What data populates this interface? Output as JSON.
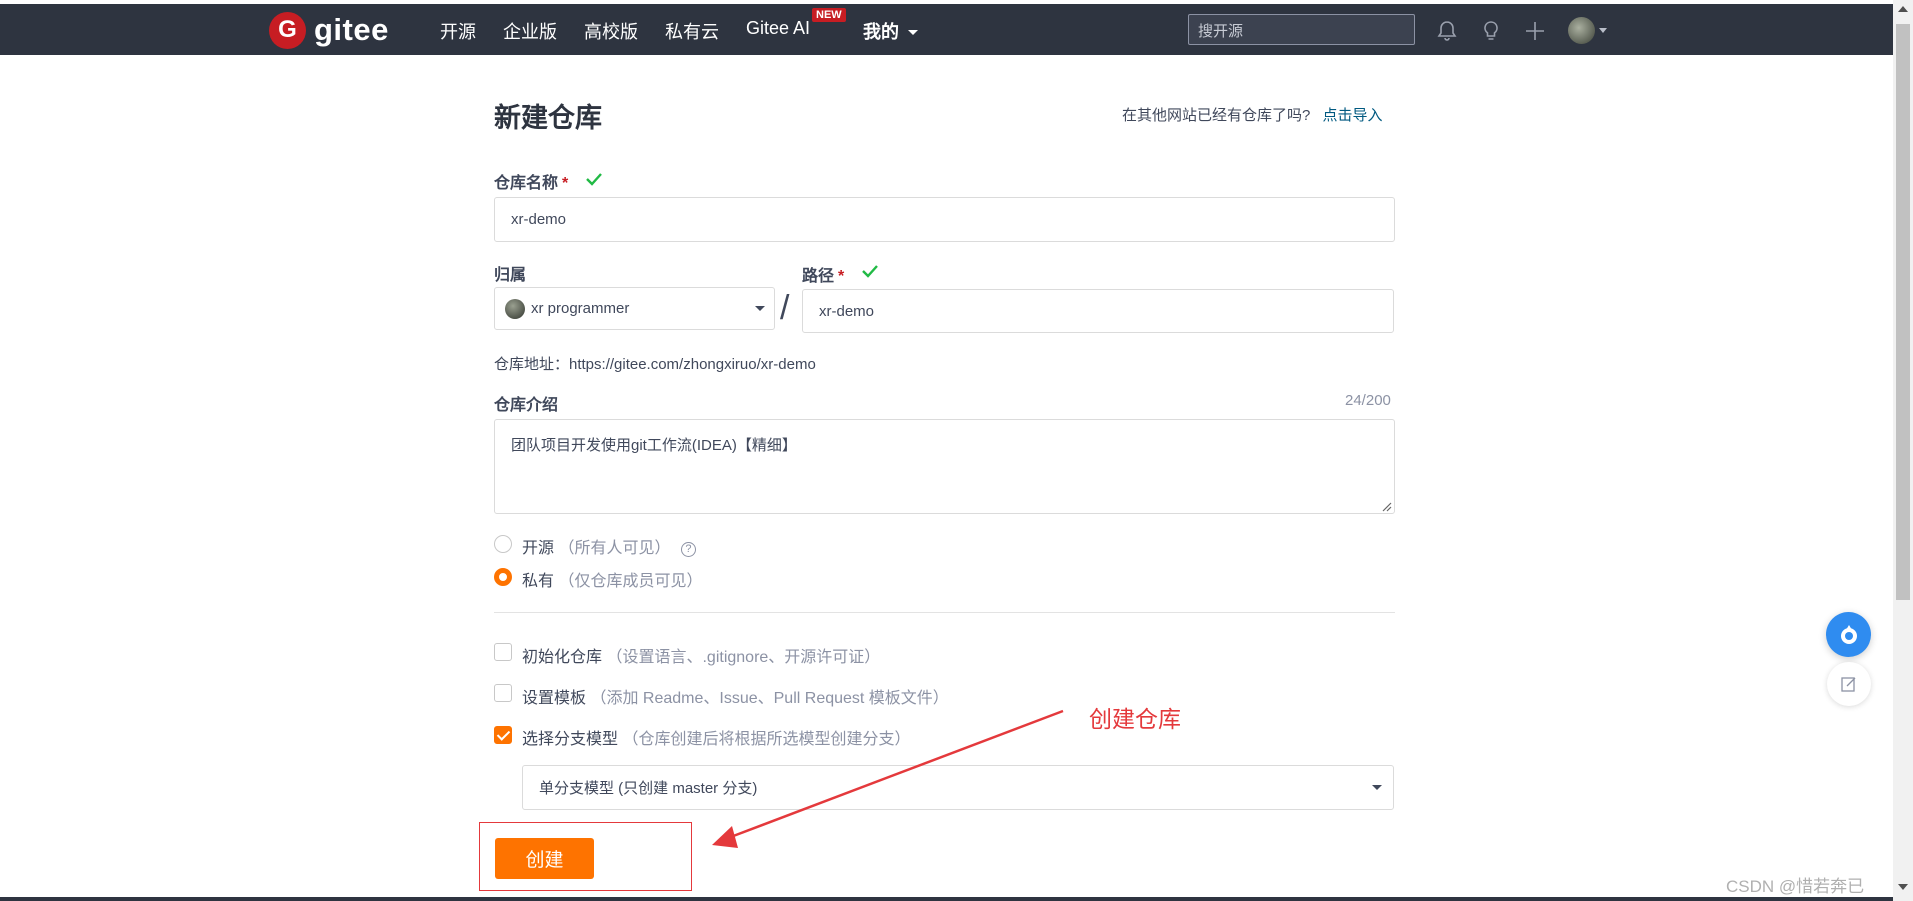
{
  "navbar": {
    "logo_text": "gitee",
    "logo_mark": "G",
    "items": [
      "开源",
      "企业版",
      "高校版",
      "私有云",
      "Gitee AI",
      "我的"
    ],
    "new_badge": "NEW",
    "search_placeholder": "搜开源",
    "icons": [
      "bell-icon",
      "lightbulb-icon",
      "plus-icon",
      "user-avatar"
    ]
  },
  "page": {
    "title": "新建仓库",
    "import_prompt": "在其他网站已经有仓库了吗?",
    "import_link": "点击导入"
  },
  "form": {
    "repo_name_label": "仓库名称",
    "repo_name_value": "xr-demo",
    "owner_label": "归属",
    "owner_value": "xr programmer",
    "path_label": "路径",
    "path_value": "xr-demo",
    "required_mark": "*",
    "separator": "/",
    "repo_url": "仓库地址：https://gitee.com/zhongxiruo/xr-demo",
    "desc_label": "仓库介绍",
    "desc_counter": "24/200",
    "desc_value": "团队项目开发使用git工作流(IDEA)【精细】",
    "visibility": [
      {
        "label": "开源",
        "hint": "（所有人可见）",
        "checked": false
      },
      {
        "label": "私有",
        "hint": "（仅仓库成员可见）",
        "checked": true
      }
    ],
    "options": [
      {
        "label": "初始化仓库",
        "hint": "（设置语言、.gitignore、开源许可证）",
        "checked": false
      },
      {
        "label": "设置模板",
        "hint": "（添加 Readme、Issue、Pull Request 模板文件）",
        "checked": false
      },
      {
        "label": "选择分支模型",
        "hint": "（仓库创建后将根据所选模型创建分支）",
        "checked": true
      }
    ],
    "branch_model_value": "单分支模型 (只创建 master 分支)",
    "help_glyph": "?",
    "submit_label": "创建"
  },
  "annotation": {
    "text": "创建仓库",
    "color": "#e4393c"
  },
  "watermark": "CSDN @惜若奔已",
  "colors": {
    "navbar_bg": "#2e3440",
    "accent_orange": "#fe7300",
    "brand_red": "#c71d23",
    "link": "#005980",
    "success_green": "#21ba45"
  }
}
